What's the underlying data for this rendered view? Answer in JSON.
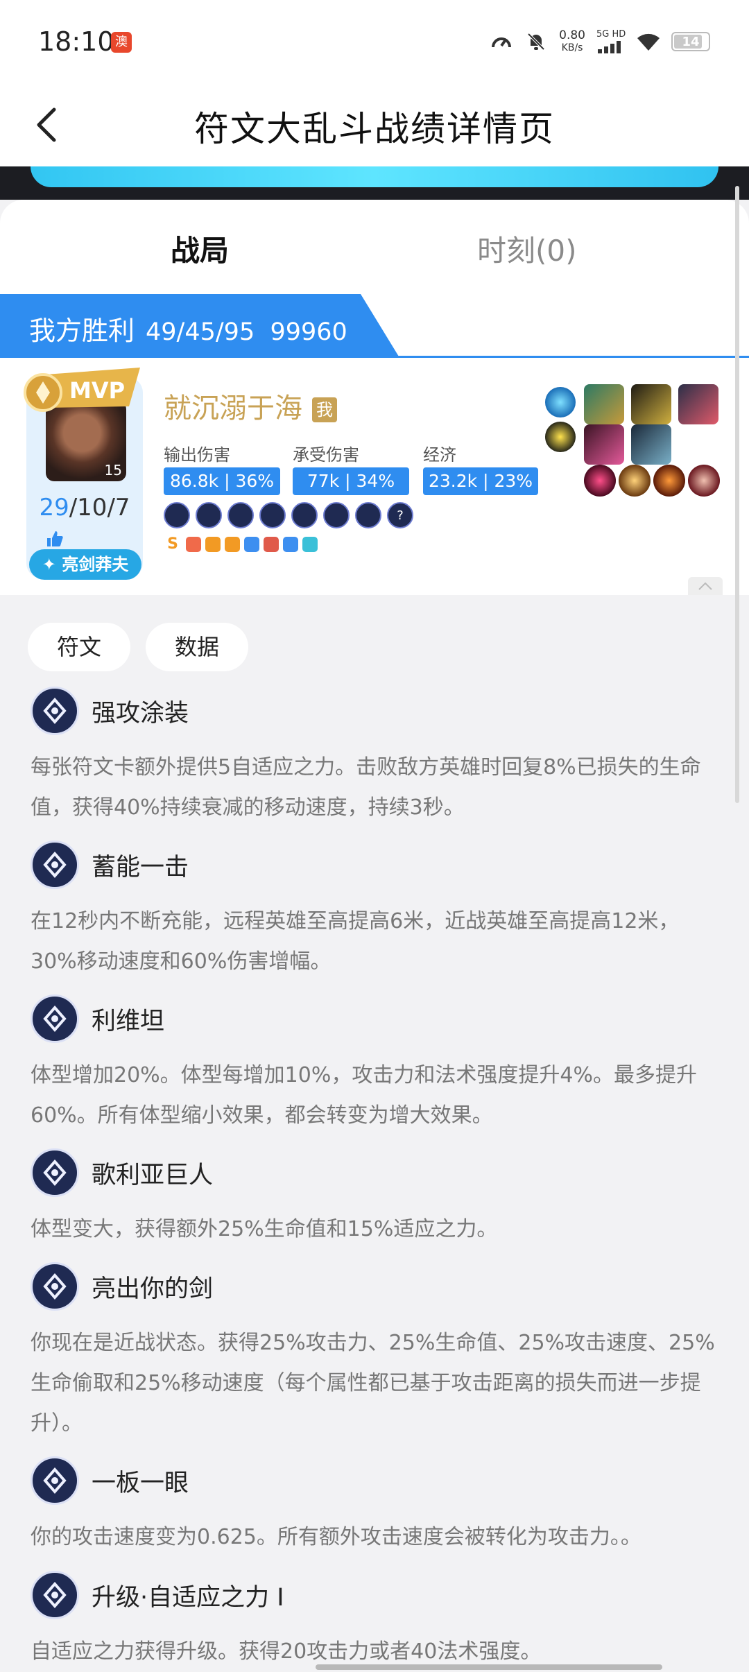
{
  "status_bar": {
    "time": "18:10",
    "app_badge": "澳",
    "net_speed_value": "0.80",
    "net_speed_unit": "KB/s",
    "signal_label_top": "5G HD",
    "battery": "14"
  },
  "nav": {
    "title": "符文大乱斗战绩详情页"
  },
  "tabs": {
    "battle": "战局",
    "moments": "时刻(0)"
  },
  "result": {
    "label": "我方胜利",
    "kda_total": "49/45/95",
    "gold": "99960"
  },
  "player": {
    "mvp_label": "MVP",
    "level": "15",
    "kda_k": "29",
    "kda_rest": "/10/7",
    "hero": "亮剑莽夫",
    "name": "就沉溺于海",
    "me_tag": "我",
    "damage_dealt_label": "输出伤害",
    "damage_dealt": "86.8k | 36%",
    "damage_taken_label": "承受伤害",
    "damage_taken": "77k | 34%",
    "economy_label": "经济",
    "economy": "23.2k | 23%",
    "rune_badges": [
      "",
      "",
      "",
      "",
      "",
      "",
      "",
      "?"
    ],
    "tags": [
      "S",
      "",
      "",
      "",
      "",
      "",
      "",
      ""
    ],
    "tag_colors": [
      "#f29a24",
      "#f06a4a",
      "#f29a24",
      "#f29a24",
      "#3d8ff0",
      "#e05a4a",
      "#3d8ff0",
      "#3ac0d8"
    ]
  },
  "subtabs": {
    "runes": "符文",
    "data": "数据"
  },
  "runes": [
    {
      "name": "强攻涂装",
      "desc": "每张符文卡额外提供5自适应之力。击败敌方英雄时回复8%已损失的生命值，获得40%持续衰减的移动速度，持续3秒。"
    },
    {
      "name": "蓄能一击",
      "desc": "在12秒内不断充能，远程英雄至高提高6米，近战英雄至高提高12米，30%移动速度和60%伤害增幅。"
    },
    {
      "name": "利维坦",
      "desc": "体型增加20%。体型每增加10%，攻击力和法术强度提升4%。最多提升60%。所有体型缩小效果，都会转变为增大效果。"
    },
    {
      "name": "歌利亚巨人",
      "desc": "体型变大，获得额外25%生命值和15%适应之力。"
    },
    {
      "name": "亮出你的剑",
      "desc": "你现在是近战状态。获得25%攻击力、25%生命值、25%攻击速度、25%生命偷取和25%移动速度（每个属性都已基于攻击距离的损失而进一步提升）。"
    },
    {
      "name": "一板一眼",
      "desc": "你的攻击速度变为0.625。所有额外攻击速度会被转化为攻击力。。"
    },
    {
      "name": "升级·自适应之力 I",
      "desc": "自适应之力获得升级。获得20攻击力或者40法术强度。"
    }
  ]
}
